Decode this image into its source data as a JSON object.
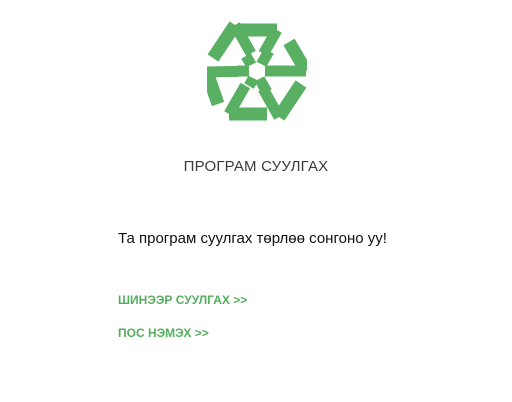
{
  "logo": {
    "icon": "hexagonal-knot-logo",
    "color": "#59b062"
  },
  "title": "ПРОГРАМ СУУЛГАХ",
  "prompt": "Та програм суулгах төрлөө сонгоно уу!",
  "options": {
    "new_install": "ШИНЭЭР СУУЛГАХ >>",
    "add_pos": "ПОС НЭМЭХ >>"
  },
  "colors": {
    "accent": "#55ad5d",
    "text": "#111111",
    "title": "#3a3a3a"
  }
}
